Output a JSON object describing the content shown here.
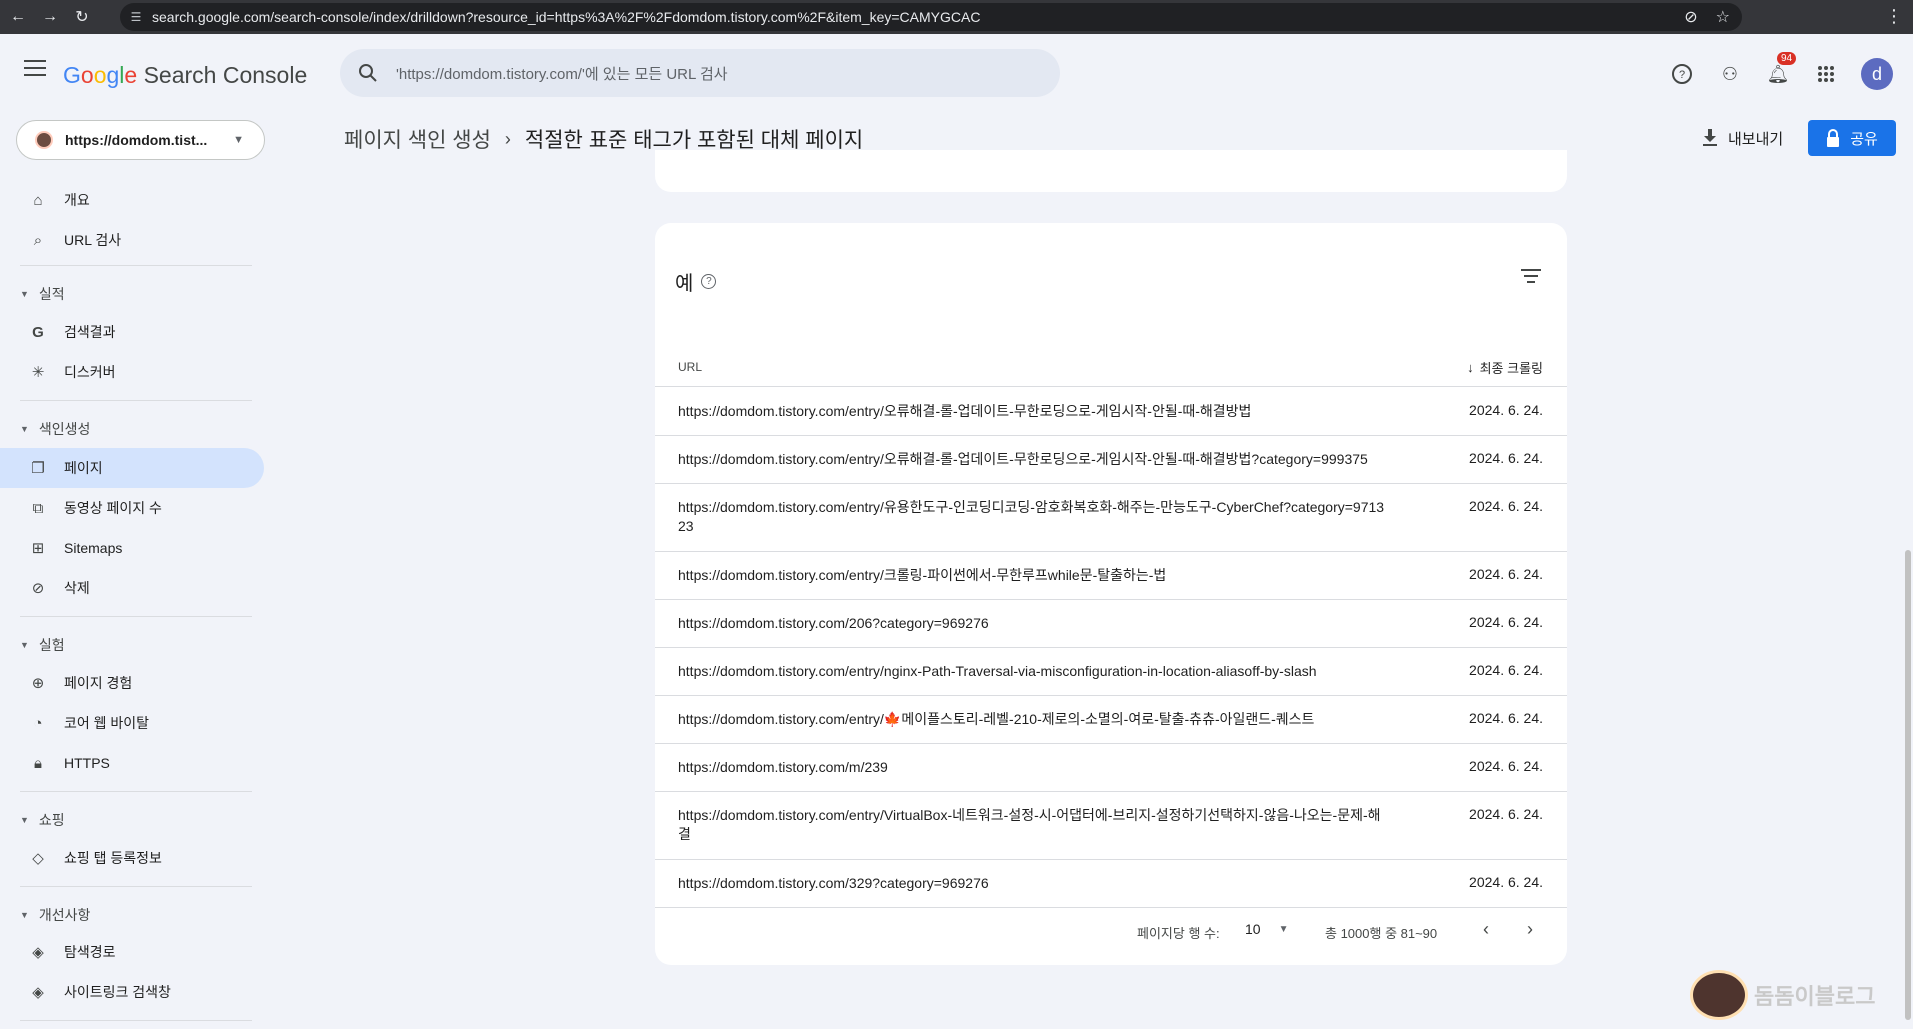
{
  "browser": {
    "url": "search.google.com/search-console/index/drilldown?resource_id=https%3A%2F%2Fdomdom.tistory.com%2F&item_key=CAMYGCAC"
  },
  "header": {
    "brand_google": "Google",
    "brand_rest": " Search Console",
    "search_placeholder": "'https://domdom.tistory.com/'에 있는 모든 URL 검사",
    "notification_count": "94",
    "avatar_letter": "d",
    "property": "https://domdom.tist...",
    "breadcrumb": [
      "페이지 색인 생성",
      "적절한 표준 태그가 포함된 대체 페이지"
    ],
    "export_label": "내보내기",
    "share_label": "공유"
  },
  "sidebar": {
    "items_top": [
      {
        "label": "개요",
        "icon": "home-icon"
      },
      {
        "label": "URL 검사",
        "icon": "search-icon"
      }
    ],
    "sections": [
      {
        "title": "실적",
        "items": [
          {
            "label": "검색결과",
            "icon": "google-g-icon"
          },
          {
            "label": "디스커버",
            "icon": "asterisk-icon"
          }
        ]
      },
      {
        "title": "색인생성",
        "items": [
          {
            "label": "페이지",
            "icon": "pages-icon",
            "active": true
          },
          {
            "label": "동영상 페이지 수",
            "icon": "video-pages-icon"
          },
          {
            "label": "Sitemaps",
            "icon": "sitemap-icon"
          },
          {
            "label": "삭제",
            "icon": "hide-icon"
          }
        ]
      },
      {
        "title": "실험",
        "items": [
          {
            "label": "페이지 경험",
            "icon": "plus-circle-icon"
          },
          {
            "label": "코어 웹 바이탈",
            "icon": "gauge-icon"
          },
          {
            "label": "HTTPS",
            "icon": "lock-icon"
          }
        ]
      },
      {
        "title": "쇼핑",
        "items": [
          {
            "label": "쇼핑 탭 등록정보",
            "icon": "tag-icon"
          }
        ]
      },
      {
        "title": "개선사항",
        "items": [
          {
            "label": "탐색경로",
            "icon": "layers-icon"
          },
          {
            "label": "사이트링크 검색창",
            "icon": "layers-icon"
          }
        ]
      }
    ]
  },
  "examples": {
    "title": "예",
    "columns": {
      "url": "URL",
      "crawled": "최종 크롤링"
    },
    "rows": [
      {
        "url": "https://domdom.tistory.com/entry/오류해결-롤-업데이트-무한로딩으로-게임시작-안될-때-해결방법",
        "date": "2024. 6. 24."
      },
      {
        "url": "https://domdom.tistory.com/entry/오류해결-롤-업데이트-무한로딩으로-게임시작-안될-때-해결방법?category=999375",
        "date": "2024. 6. 24."
      },
      {
        "url": "https://domdom.tistory.com/entry/유용한도구-인코딩디코딩-암호화복호화-해주는-만능도구-CyberChef?category=971323",
        "date": "2024. 6. 24."
      },
      {
        "url": "https://domdom.tistory.com/entry/크롤링-파이썬에서-무한루프while문-탈출하는-법",
        "date": "2024. 6. 24."
      },
      {
        "url": "https://domdom.tistory.com/206?category=969276",
        "date": "2024. 6. 24."
      },
      {
        "url": "https://domdom.tistory.com/entry/nginx-Path-Traversal-via-misconfiguration-in-location-aliasoff-by-slash",
        "date": "2024. 6. 24."
      },
      {
        "url": "https://domdom.tistory.com/entry/🍁메이플스토리-레벨-210-제로의-소멸의-여로-탈출-츄츄-아일랜드-퀘스트",
        "date": "2024. 6. 24."
      },
      {
        "url": "https://domdom.tistory.com/m/239",
        "date": "2024. 6. 24."
      },
      {
        "url": "https://domdom.tistory.com/entry/VirtualBox-네트워크-설정-시-어댑터에-브리지-설정하기선택하지-않음-나오는-문제-해결",
        "date": "2024. 6. 24."
      },
      {
        "url": "https://domdom.tistory.com/329?category=969276",
        "date": "2024. 6. 24."
      }
    ],
    "pager": {
      "rows_per_page_label": "페이지당 행 수:",
      "rows_per_page": "10",
      "range": "총 1000행 중 81~90"
    }
  },
  "watermark": "돔돔이블로그"
}
